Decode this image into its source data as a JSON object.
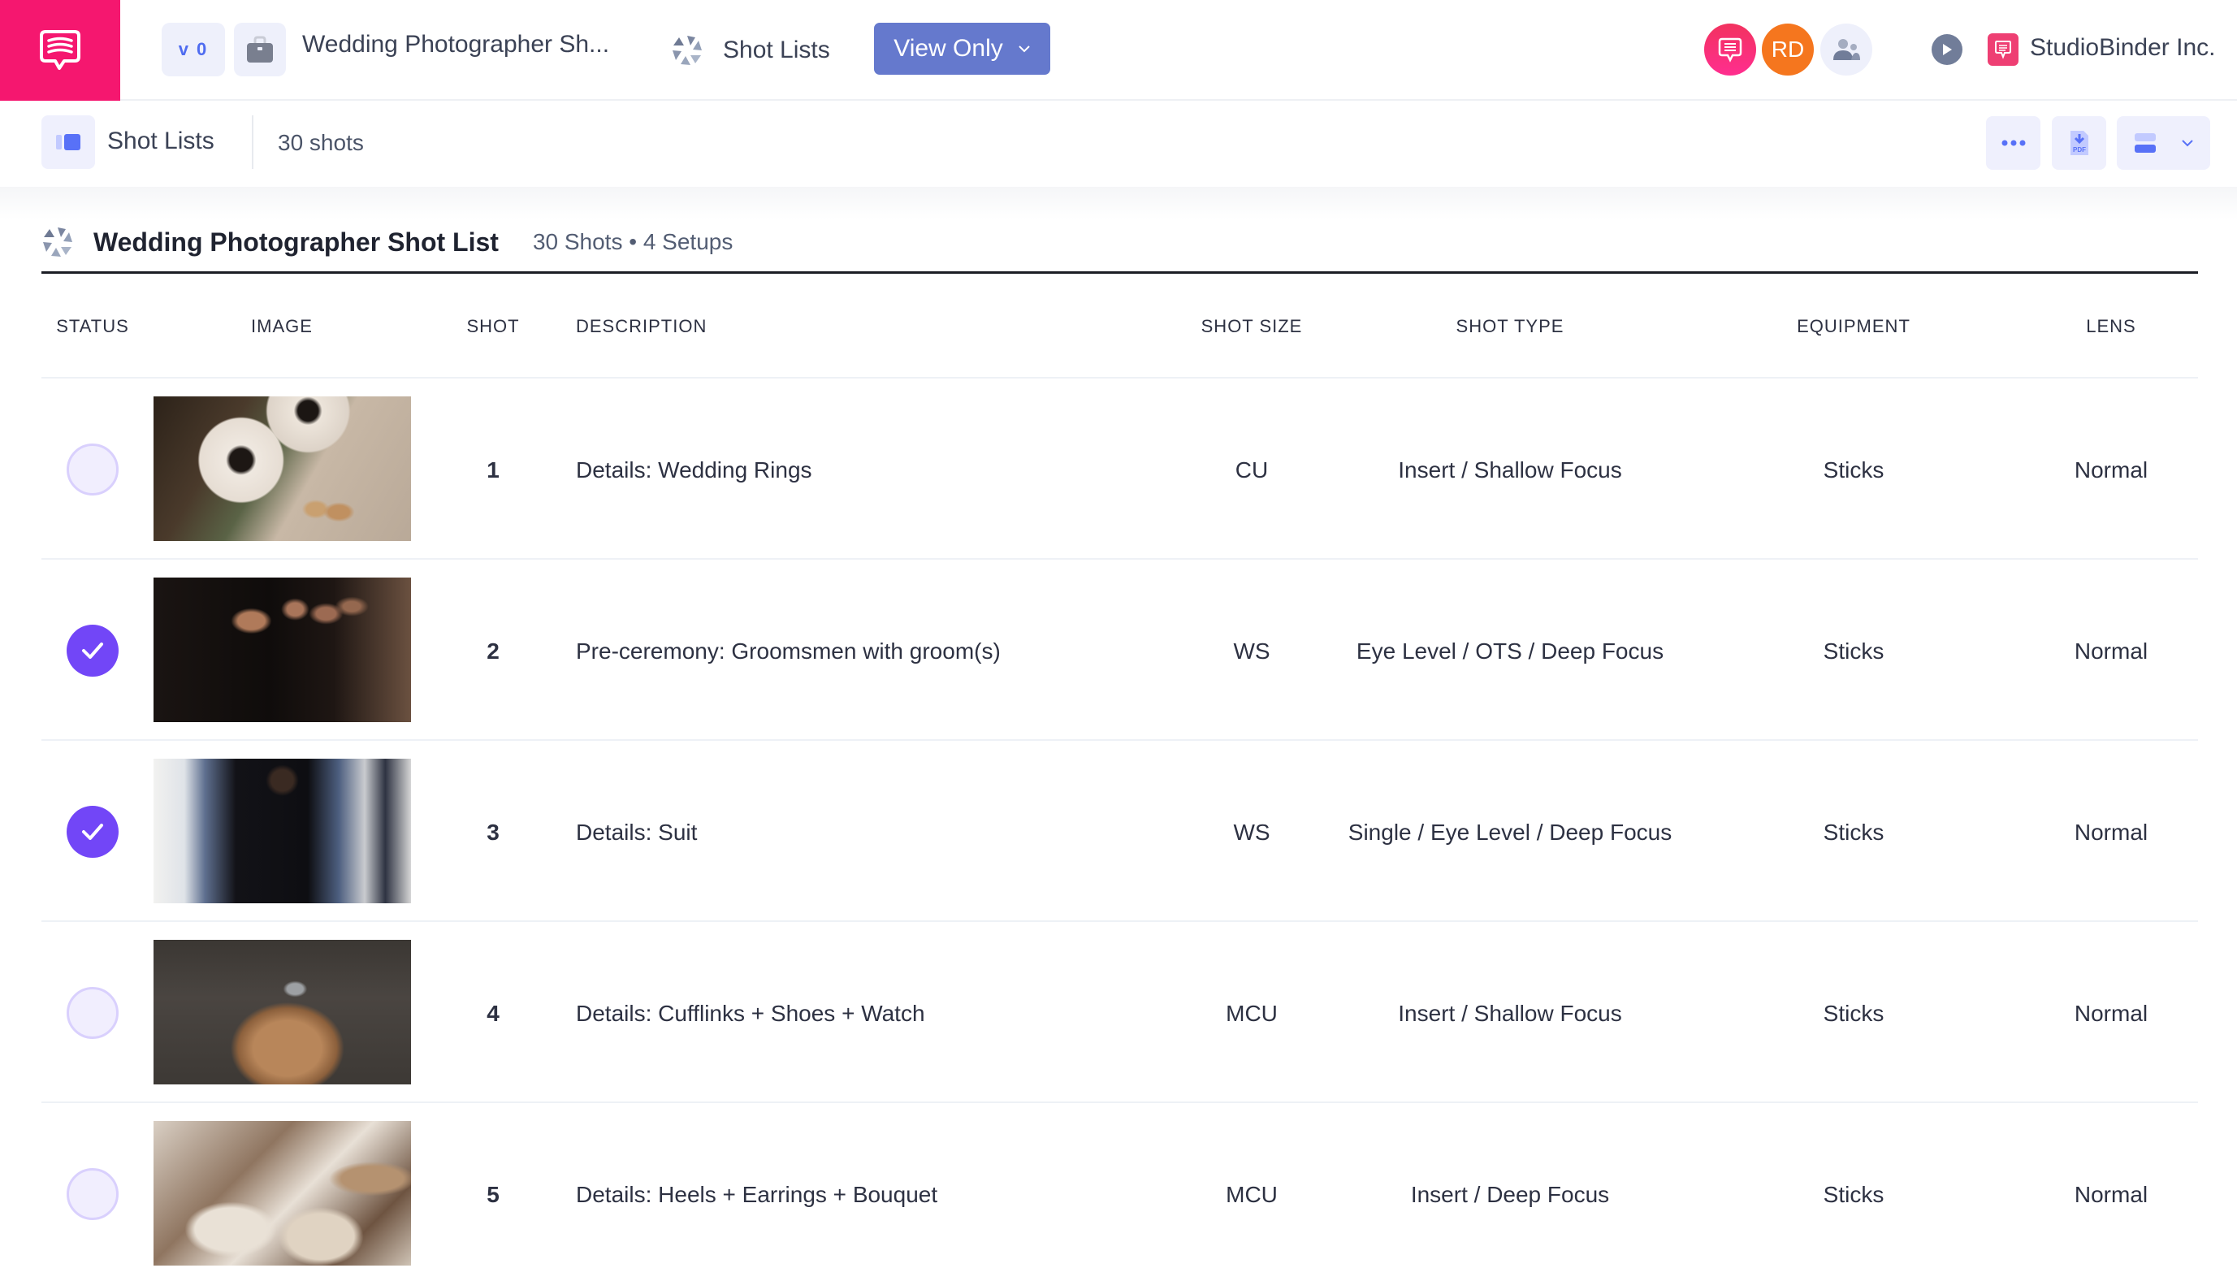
{
  "topbar": {
    "version": "v 0",
    "project_title": "Wedding Photographer Sh...",
    "nav_label": "Shot Lists",
    "view_mode": "View Only",
    "user_initials": "RD",
    "org_name": "StudioBinder Inc."
  },
  "subbar": {
    "title": "Shot Lists",
    "shot_count": "30 shots"
  },
  "list": {
    "title": "Wedding Photographer Shot List",
    "meta": "30 Shots • 4 Setups"
  },
  "table": {
    "headers": {
      "status": "STATUS",
      "image": "IMAGE",
      "shot": "SHOT",
      "description": "DESCRIPTION",
      "shot_size": "SHOT SIZE",
      "shot_type": "SHOT TYPE",
      "equipment": "EQUIPMENT",
      "lens": "LENS"
    },
    "rows": [
      {
        "done": false,
        "image": "wedding rings with anemone flowers",
        "shot": "1",
        "description": "Details: Wedding Rings",
        "shot_size": "CU",
        "shot_type": "Insert / Shallow Focus",
        "equipment": "Sticks",
        "lens": "Normal"
      },
      {
        "done": true,
        "image": "groom with groomsmen in dark suits",
        "shot": "2",
        "description": "Pre-ceremony: Groomsmen with groom(s)",
        "shot_size": "WS",
        "shot_type": "Eye Level / OTS / Deep Focus",
        "equipment": "Sticks",
        "lens": "Normal"
      },
      {
        "done": true,
        "image": "groom in suit seated in armchair",
        "shot": "3",
        "description": "Details: Suit",
        "shot_size": "WS",
        "shot_type": "Single / Eye Level / Deep Focus",
        "equipment": "Sticks",
        "lens": "Normal"
      },
      {
        "done": false,
        "image": "brown brogue shoe, watch and cufflinks",
        "shot": "4",
        "description": "Details: Cufflinks + Shoes + Watch",
        "shot_size": "MCU",
        "shot_type": "Insert / Shallow Focus",
        "equipment": "Sticks",
        "lens": "Normal"
      },
      {
        "done": false,
        "image": "heels, earrings, bouquet and invitations",
        "shot": "5",
        "description": "Details: Heels + Earrings + Bouquet",
        "shot_size": "MCU",
        "shot_type": "Insert / Deep Focus",
        "equipment": "Sticks",
        "lens": "Normal"
      }
    ]
  },
  "colors": {
    "brand_pink": "#f5176f",
    "accent_blue": "#6579cd",
    "status_done": "#7246f7",
    "status_pending": "#f1eefe",
    "avatar_orange": "#f5761e"
  }
}
